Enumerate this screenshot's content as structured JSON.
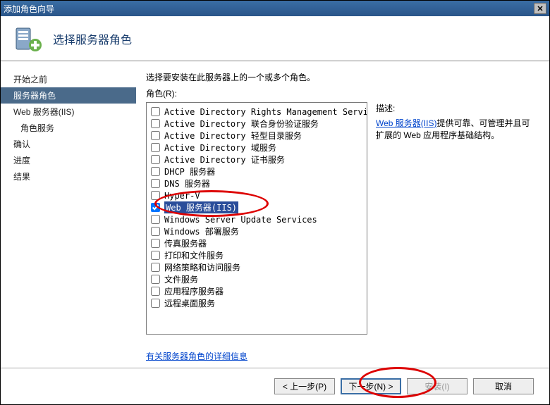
{
  "window": {
    "title": "添加角色向导"
  },
  "header": {
    "title": "选择服务器角色"
  },
  "sidebar": {
    "items": [
      {
        "label": "开始之前",
        "indent": 0,
        "selected": false
      },
      {
        "label": "服务器角色",
        "indent": 0,
        "selected": true
      },
      {
        "label": "Web 服务器(IIS)",
        "indent": 0,
        "selected": false
      },
      {
        "label": "角色服务",
        "indent": 1,
        "selected": false
      },
      {
        "label": "确认",
        "indent": 0,
        "selected": false
      },
      {
        "label": "进度",
        "indent": 0,
        "selected": false
      },
      {
        "label": "结果",
        "indent": 0,
        "selected": false
      }
    ]
  },
  "main": {
    "instruction": "选择要安装在此服务器上的一个或多个角色。",
    "rolesLabel": "角色(R):",
    "roles": [
      {
        "label": "Active Directory Rights Management Services",
        "checked": false,
        "selected": false
      },
      {
        "label": "Active Directory 联合身份验证服务",
        "checked": false,
        "selected": false
      },
      {
        "label": "Active Directory 轻型目录服务",
        "checked": false,
        "selected": false
      },
      {
        "label": "Active Directory 域服务",
        "checked": false,
        "selected": false
      },
      {
        "label": "Active Directory 证书服务",
        "checked": false,
        "selected": false
      },
      {
        "label": "DHCP 服务器",
        "checked": false,
        "selected": false
      },
      {
        "label": "DNS 服务器",
        "checked": false,
        "selected": false
      },
      {
        "label": "Hyper-V",
        "checked": false,
        "selected": false
      },
      {
        "label": "Web 服务器(IIS)",
        "checked": true,
        "selected": true
      },
      {
        "label": "Windows Server Update Services",
        "checked": false,
        "selected": false
      },
      {
        "label": "Windows 部署服务",
        "checked": false,
        "selected": false
      },
      {
        "label": "传真服务器",
        "checked": false,
        "selected": false
      },
      {
        "label": "打印和文件服务",
        "checked": false,
        "selected": false
      },
      {
        "label": "网络策略和访问服务",
        "checked": false,
        "selected": false
      },
      {
        "label": "文件服务",
        "checked": false,
        "selected": false
      },
      {
        "label": "应用程序服务器",
        "checked": false,
        "selected": false
      },
      {
        "label": "远程桌面服务",
        "checked": false,
        "selected": false
      }
    ],
    "descLabel": "描述:",
    "descLink": "Web 服务器(IIS)",
    "descText": "提供可靠、可管理并且可扩展的 Web 应用程序基础结构。",
    "moreInfo": "有关服务器角色的详细信息"
  },
  "footer": {
    "prev": "< 上一步(P)",
    "next": "下一步(N) >",
    "install": "安装(I)",
    "cancel": "取消"
  }
}
